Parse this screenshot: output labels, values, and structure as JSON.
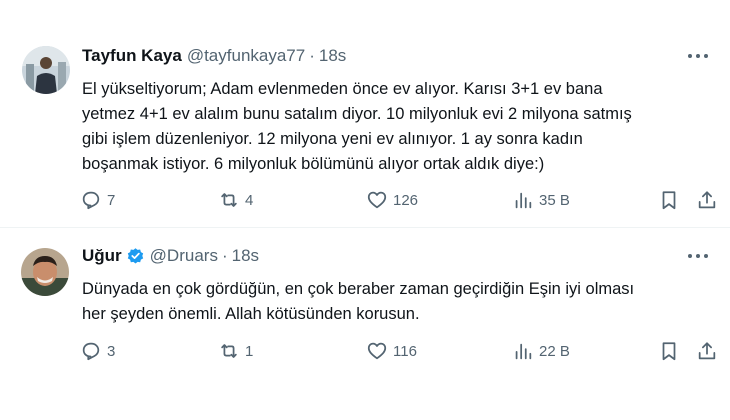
{
  "tweets": [
    {
      "name": "Tayfun Kaya",
      "handle": "@tayfunkaya77",
      "separator": "·",
      "time": "18s",
      "verified": false,
      "text_lines": [
        "El yükseltiyorum; Adam evlenmeden önce ev alıyor. Karısı 3+1 ev bana",
        "yetmez 4+1 ev alalım bunu satalım diyor. 10 milyonluk evi 2 milyona satmış",
        "gibi işlem düzenleniyor. 12 milyona yeni ev alınıyor. 1 ay sonra kadın",
        "boşanmak istiyor. 6 milyonluk bölümünü alıyor ortak aldık diye:)"
      ],
      "replies": "7",
      "retweets": "4",
      "likes": "126",
      "views": "35 B"
    },
    {
      "name": "Uğur",
      "handle": "@Druars",
      "separator": "·",
      "time": "18s",
      "verified": true,
      "text_lines": [
        "Dünyada en çok gördüğün, en çok beraber zaman geçirdiğin Eşin iyi olması",
        "her şeyden önemli. Allah kötüsünden korusun."
      ],
      "replies": "3",
      "retweets": "1",
      "likes": "116",
      "views": "22 B"
    }
  ],
  "colors": {
    "text": "#0f1419",
    "secondary": "#536471",
    "verified_badge": "#1d9bf0",
    "divider": "#eff3f4"
  },
  "icons": {
    "reply": "reply-icon",
    "retweet": "retweet-icon",
    "like": "heart-icon",
    "views": "views-chart-icon",
    "bookmark": "bookmark-icon",
    "share": "share-icon",
    "more": "more-dots-icon",
    "verified": "verified-badge-icon"
  }
}
